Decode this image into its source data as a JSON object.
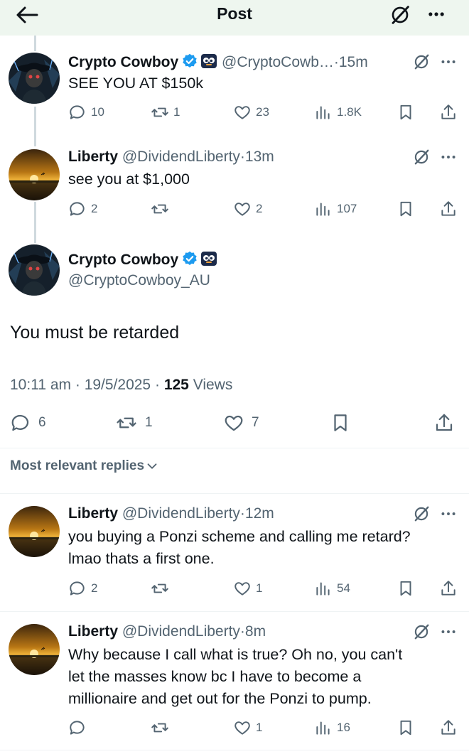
{
  "header": {
    "title": "Post"
  },
  "thread": [
    {
      "name": "Crypto Cowboy",
      "handle": "@CryptoCowb…",
      "time": "15m",
      "text": "SEE YOU AT $150k",
      "stats": {
        "replies": "10",
        "reposts": "1",
        "likes": "23",
        "views": "1.8K"
      }
    },
    {
      "name": "Liberty",
      "handle": "@DividendLiberty",
      "time": "13m",
      "text": "see you at $1,000",
      "stats": {
        "replies": "2",
        "reposts": "",
        "likes": "2",
        "views": "107"
      }
    }
  ],
  "main": {
    "name": "Crypto Cowboy",
    "handle": "@CryptoCowboy_AU",
    "text": "You must be retarded",
    "time": "10:11 am",
    "date": "19/5/2025",
    "views_count": "125",
    "views_label": "Views",
    "stats": {
      "replies": "6",
      "reposts": "1",
      "likes": "7"
    }
  },
  "replies_sort": "Most relevant replies",
  "replies": [
    {
      "name": "Liberty",
      "handle": "@DividendLiberty",
      "time": "12m",
      "lines": [
        "you buying a Ponzi scheme and calling me retard?",
        "lmao thats a first one."
      ],
      "stats": {
        "replies": "2",
        "reposts": "",
        "likes": "1",
        "views": "54"
      }
    },
    {
      "name": "Liberty",
      "handle": "@DividendLiberty",
      "time": "8m",
      "lines": [
        "Why because I call what is true? Oh no, you can't",
        "let the masses know bc I have to become a",
        "millionaire and get out for the Ponzi to pump."
      ],
      "stats": {
        "replies": "",
        "reposts": "",
        "likes": "1",
        "views": "16"
      }
    }
  ],
  "separator": "·",
  "icons": [
    "back-arrow-icon",
    "grok-icon",
    "more-icon",
    "verified-icon",
    "reply-icon",
    "repost-icon",
    "like-icon",
    "views-icon",
    "bookmark-icon",
    "share-icon",
    "chevron-down-icon"
  ],
  "colors": {
    "verified": "#1d9bf0",
    "secondary_text": "#536471",
    "header_bg": "#eef6ef"
  }
}
